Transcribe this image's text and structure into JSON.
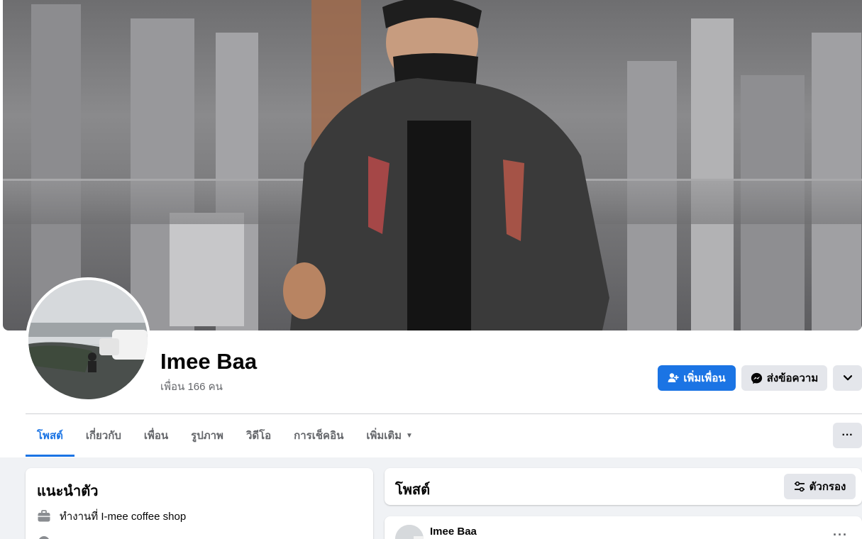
{
  "profile": {
    "name": "Imee Baa",
    "friends_text": "เพื่อน 166 คน"
  },
  "actions": {
    "add_friend": "เพิ่มเพื่อน",
    "message": "ส่งข้อความ",
    "more_icon": "chevron-down-icon"
  },
  "tabs": [
    {
      "label": "โพสต์",
      "active": true
    },
    {
      "label": "เกี่ยวกับ"
    },
    {
      "label": "เพื่อน"
    },
    {
      "label": "รูปภาพ"
    },
    {
      "label": "วิดีโอ"
    },
    {
      "label": "การเช็คอิน"
    },
    {
      "label": "เพิ่มเติม"
    }
  ],
  "tabs_more_icon": "more-dots-icon",
  "intro": {
    "title": "แนะนำตัว",
    "work": "ทำงานที่ I-mee coffee shop"
  },
  "posts": {
    "title": "โพสต์",
    "filter_label": "ตัวกรอง"
  },
  "post": {
    "author": "Imee Baa"
  },
  "colors": {
    "accent": "#1b74e4",
    "secondary_button": "#e4e6eb",
    "background": "#f0f2f5"
  }
}
